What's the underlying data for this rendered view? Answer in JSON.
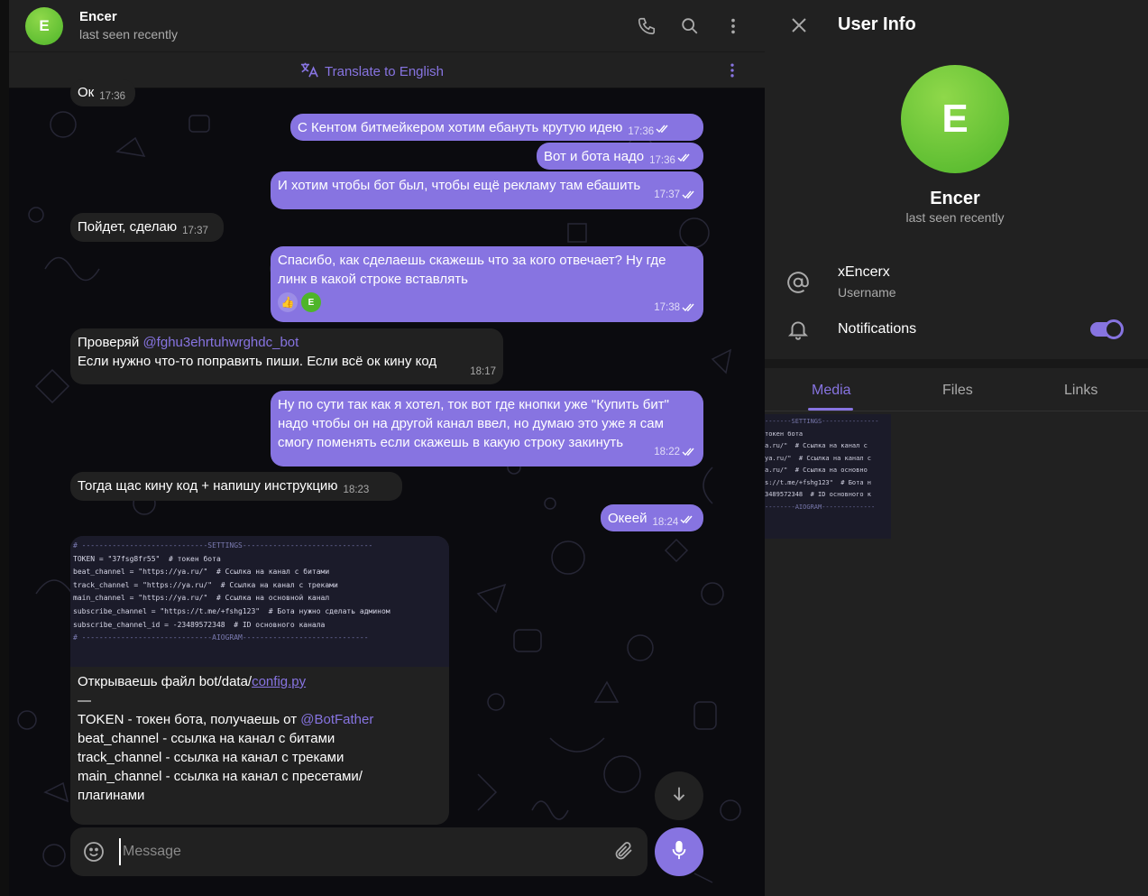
{
  "chat": {
    "header": {
      "avatar_letter": "E",
      "name": "Encer",
      "status": "last seen recently"
    },
    "translate": {
      "label": "Translate to English"
    },
    "messages": [
      {
        "dir": "in",
        "text": "Ок",
        "time": "17:36"
      },
      {
        "dir": "out",
        "text": "С Кентом битмейкером хотим ебануть крутую идею",
        "time": "17:36"
      },
      {
        "dir": "out",
        "text": "Вот и бота надо",
        "time": "17:36"
      },
      {
        "dir": "out",
        "text": "И хотим чтобы бот был, чтобы ещё рекламу там ебашить",
        "time": "17:37"
      },
      {
        "dir": "in",
        "text": "Пойдет, сделаю",
        "time": "17:37"
      },
      {
        "dir": "out",
        "text": "Спасибо, как сделаешь скажешь что за кого отвечает? Ну где линк в какой строке вставлять",
        "time": "17:38",
        "reaction": "👍",
        "reaction_avatar": "E"
      },
      {
        "dir": "in",
        "text_prefix": "Проверяй ",
        "mention": "@fghu3ehrtuhwrghdc_bot",
        "text_suffix": "Если нужно что-то поправить пиши. Если всё ок кину код",
        "time": "18:17"
      },
      {
        "dir": "out",
        "text": "Ну по сути так как я хотел, ток вот где кнопки уже \"Купить бит\" надо чтобы он на другой канал ввел, но думаю это уже я сам смогу поменять если скажешь в какую строку закинуть",
        "time": "18:22"
      },
      {
        "dir": "in",
        "text": "Тогда щас кину код + напишу инструкцию",
        "time": "18:23"
      },
      {
        "dir": "out",
        "text": "Океей",
        "time": "18:24"
      }
    ],
    "code_message": {
      "code_lines": [
        "# -----------------------------SETTINGS------------------------------",
        "TOKEN = \"37fsg8fr55\"  # токен бота",
        "",
        "beat_channel = \"https://ya.ru/\"  # Ссылка на канал с битами",
        "track_channel = \"https://ya.ru/\"  # Ссылка на канал с треками",
        "main_channel = \"https://ya.ru/\"  # Ссылка на основной канал",
        "",
        "subscribe_channel = \"https://t.me/+fshg123\"  # Бота нужно сделать админом",
        "subscribe_channel_id = -23489572348  # ID основного канала",
        "# ------------------------------AIOGRAM-----------------------------"
      ],
      "line1_prefix": "Открываешь файл bot/data/",
      "line1_link": "config.py",
      "line2": "—",
      "line3_prefix": "TOKEN - токен бота, получаешь от ",
      "line3_mention": "@BotFather",
      "line4": "beat_channel - ссылка на канал с битами",
      "line5": "track_channel - ссылка на канал с треками",
      "line6": "main_channel - ссылка на канал с пресетами/",
      "line7": "плагинами"
    },
    "composer": {
      "placeholder": "Message"
    }
  },
  "panel": {
    "title": "User Info",
    "avatar_letter": "E",
    "name": "Encer",
    "status": "last seen recently",
    "username": "xEncerx",
    "username_label": "Username",
    "notifications_label": "Notifications",
    "notifications_on": true,
    "tabs": [
      "Media",
      "Files",
      "Links"
    ],
    "media_thumb_lines": [
      "-------SETTINGS---------------",
      "токен бота",
      "",
      "a.ru/\"  # Ссылка на канал с",
      "ya.ru/\"  # Ссылка на канал с",
      "a.ru/\"  # Ссылка на основно",
      "",
      "s://t.me/+fshg123\"  # Бота н",
      "3489572348  # ID основного к",
      "--------AIOGRAM--------------"
    ]
  },
  "colors": {
    "accent": "#8774e1",
    "bubble_in": "#212121",
    "bubble_out": "#8774e1",
    "avatar": "#4eb52a"
  },
  "icons": [
    "phone-icon",
    "search-icon",
    "more-vertical-icon",
    "translate-icon",
    "close-icon",
    "at-sign-icon",
    "bell-icon",
    "smile-icon",
    "paperclip-icon",
    "microphone-icon",
    "arrow-down-icon",
    "double-check-icon"
  ]
}
